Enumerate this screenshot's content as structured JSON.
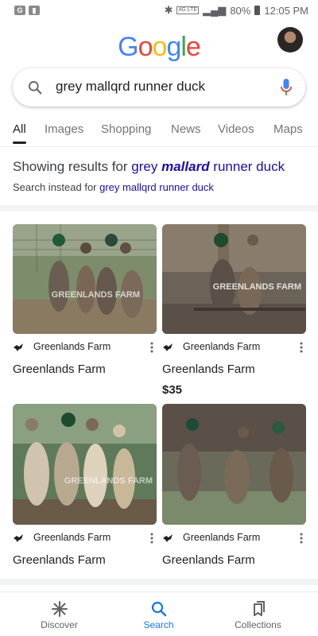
{
  "status_bar": {
    "left_badges": [
      "G",
      "▮"
    ],
    "network_tag": "4G LTE",
    "battery": "80%",
    "time": "12:05 PM"
  },
  "header": {
    "logo_letters": [
      "G",
      "o",
      "o",
      "g",
      "l",
      "e"
    ],
    "logo_colors": [
      "#4285f4",
      "#ea4335",
      "#fbbc05",
      "#4285f4",
      "#34a853",
      "#ea4335"
    ]
  },
  "search": {
    "query": "grey mallqrd runner duck"
  },
  "tabs": [
    {
      "label": "All"
    },
    {
      "label": "Images"
    },
    {
      "label": "Shopping"
    },
    {
      "label": "News"
    },
    {
      "label": "Videos"
    },
    {
      "label": "Maps"
    }
  ],
  "correction": {
    "showing_prefix": "Showing results for ",
    "corrected_before": "grey ",
    "corrected_bold": "mallard",
    "corrected_after": " runner duck",
    "instead_prefix": "Search instead for ",
    "original_query": "grey mallqrd runner duck"
  },
  "results": [
    {
      "source": "Greenlands Farm",
      "title": "Greenlands Farm",
      "price": ""
    },
    {
      "source": "Greenlands Farm",
      "title": "Greenlands Farm",
      "price": "$35"
    },
    {
      "source": "Greenlands Farm",
      "title": "Greenlands Farm",
      "price": ""
    },
    {
      "source": "Greenlands Farm",
      "title": "Greenlands Farm",
      "price": ""
    }
  ],
  "watermark": "GREENLANDS FARM",
  "bottom_nav": [
    {
      "label": "Discover",
      "icon": "asterisk-icon"
    },
    {
      "label": "Search",
      "icon": "search-icon"
    },
    {
      "label": "Collections",
      "icon": "collections-icon"
    }
  ],
  "colors": {
    "link": "#1a0dab",
    "active_nav": "#1a73e8",
    "mic_blue": "#4285f4",
    "mic_red": "#ea4335"
  }
}
